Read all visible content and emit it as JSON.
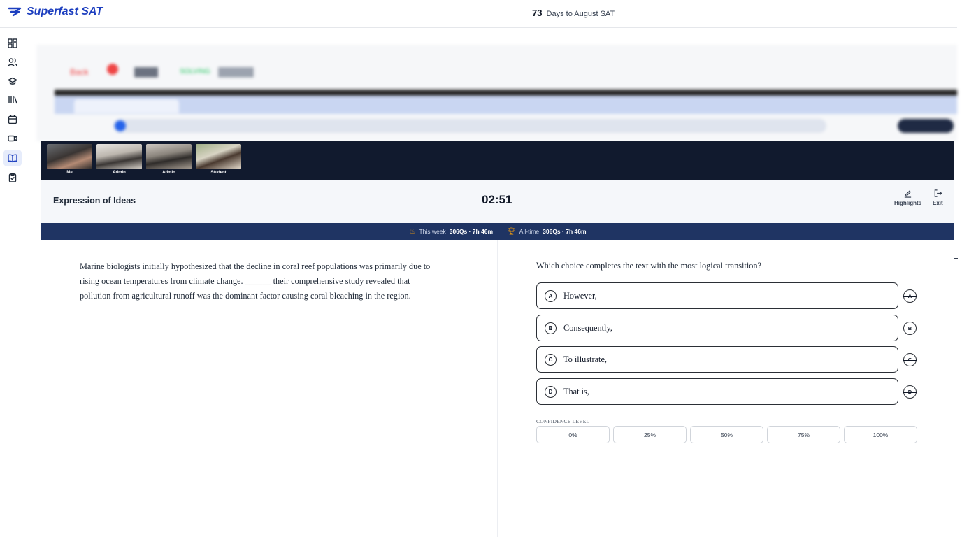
{
  "topbar": {
    "brand": "Superfast SAT",
    "countdown_number": "73",
    "countdown_text": "Days to August SAT"
  },
  "sidebar": {
    "items": [
      {
        "icon": "dashboard-icon"
      },
      {
        "icon": "users-icon"
      },
      {
        "icon": "graduation-cap-icon"
      },
      {
        "icon": "library-icon"
      },
      {
        "icon": "calendar-icon"
      },
      {
        "icon": "video-icon"
      },
      {
        "icon": "book-open-icon",
        "active": true
      },
      {
        "icon": "clipboard-check-icon"
      }
    ]
  },
  "shared_screen": {
    "back_label": "Back",
    "status": "SOLVING",
    "video_tiles": [
      {
        "label": "Me"
      },
      {
        "label": "Admin"
      },
      {
        "label": "Admin"
      },
      {
        "label": "Student"
      }
    ],
    "quiz": {
      "section_title": "Expression of Ideas",
      "timer": "02:51",
      "highlights_label": "Highlights",
      "exit_label": "Exit"
    },
    "stats": {
      "week_label": "This week",
      "week_value": "306Qs · 7h 46m",
      "alltime_label": "All-time",
      "alltime_value": "306Qs · 7h 46m"
    },
    "passage_lines": [
      "Marine biologists initially hypothesized that the decline in coral reef populations was primarily due to",
      "rising ocean temperatures from climate change. ______ their comprehensive study revealed that",
      "pollution from agricultural runoff was the dominant factor causing coral bleaching in the region."
    ],
    "question": "Which choice completes the text with the most logical transition?",
    "choices": [
      {
        "letter": "A",
        "text": "However,"
      },
      {
        "letter": "B",
        "text": "Consequently,"
      },
      {
        "letter": "C",
        "text": "To illustrate,"
      },
      {
        "letter": "D",
        "text": "That is,"
      }
    ],
    "confidence_label": "CONFIDENCE LEVEL",
    "confidence_options": [
      "0%",
      "25%",
      "50%",
      "75%",
      "100%"
    ]
  },
  "colors": {
    "brand": "#1d3fbf",
    "stats_bar": "#1f3463",
    "video_strip": "#111a2e"
  }
}
